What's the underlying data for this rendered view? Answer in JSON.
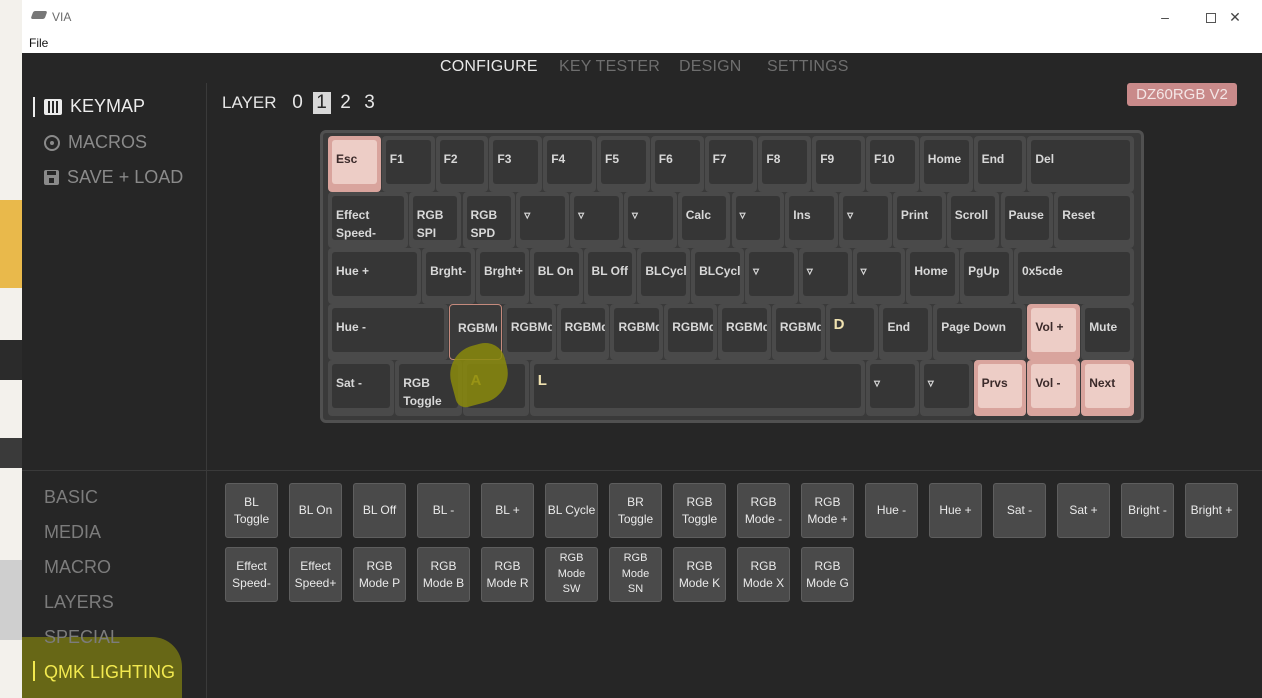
{
  "window": {
    "title": "VIA",
    "menu": [
      "File"
    ],
    "controls": {
      "minimize": "–",
      "maximize": "□",
      "close": "✕"
    }
  },
  "nav": {
    "tabs": [
      {
        "label": "CONFIGURE",
        "active": true
      },
      {
        "label": "KEY TESTER",
        "active": false
      },
      {
        "label": "DESIGN",
        "active": false
      },
      {
        "label": "SETTINGS",
        "active": false
      }
    ]
  },
  "sidebar": {
    "items": [
      {
        "label": "KEYMAP",
        "icon": "keyboard-icon",
        "active": true
      },
      {
        "label": "MACROS",
        "icon": "macro-icon",
        "active": false
      },
      {
        "label": "SAVE + LOAD",
        "icon": "save-icon",
        "active": false
      }
    ]
  },
  "layers": {
    "label": "LAYER",
    "items": [
      "0",
      "1",
      "2",
      "3"
    ],
    "selected": "1"
  },
  "device": {
    "name": "DZ60RGB V2",
    "color": "#c98a8a"
  },
  "keyboard": {
    "rows": [
      [
        "Esc",
        "F1",
        "F2",
        "F3",
        "F4",
        "F5",
        "F6",
        "F7",
        "F8",
        "F9",
        "F10",
        "Home",
        "End",
        "Del"
      ],
      [
        "Effect\nSpeed-",
        "RGB\nSPI",
        "RGB\nSPD",
        "▿",
        "▿",
        "▿",
        "Calc",
        "▿",
        "Ins",
        "▿",
        "Print",
        "Scroll",
        "Pause",
        "Reset"
      ],
      [
        "Hue +",
        "Brght-",
        "Brght+",
        "BL On",
        "BL Off",
        "BLCycl",
        "BLCycl",
        "▿",
        "▿",
        "▿",
        "Home",
        "PgUp",
        "0x5cde"
      ],
      [
        "Hue -",
        "RGBMdSW",
        "RGBMdl",
        "RGBMdl",
        "RGBMdl",
        "RGBMdl",
        "RGBMd:",
        "RGBMd(",
        "D",
        "End",
        "Page Down",
        "Vol +",
        "Mute"
      ],
      [
        "Sat -",
        "RGB\nToggle",
        "A",
        "L",
        "▿",
        "▿",
        "Prvs",
        "Vol -",
        "Next"
      ]
    ]
  },
  "categories": {
    "items": [
      "BASIC",
      "MEDIA",
      "MACRO",
      "LAYERS",
      "SPECIAL",
      "QMK LIGHTING"
    ],
    "selected": "QMK LIGHTING"
  },
  "lighting_buttons": [
    "BL\nToggle",
    "BL On",
    "BL Off",
    "BL -",
    "BL +",
    "BL Cycle",
    "BR\nToggle",
    "RGB\nToggle",
    "RGB\nMode -",
    "RGB\nMode +",
    "Hue -",
    "Hue +",
    "Sat -",
    "Sat +",
    "Bright -",
    "Bright +",
    "Effect\nSpeed-",
    "Effect\nSpeed+",
    "RGB\nMode P",
    "RGB\nMode B",
    "RGB\nMode R",
    "RGB\nMode\nSW",
    "RGB\nMode\nSN",
    "RGB\nMode K",
    "RGB\nMode X",
    "RGB\nMode G"
  ],
  "colors": {
    "background": "#262626",
    "accent_key": "#edcdc6",
    "highlight": "#f2e94f"
  }
}
